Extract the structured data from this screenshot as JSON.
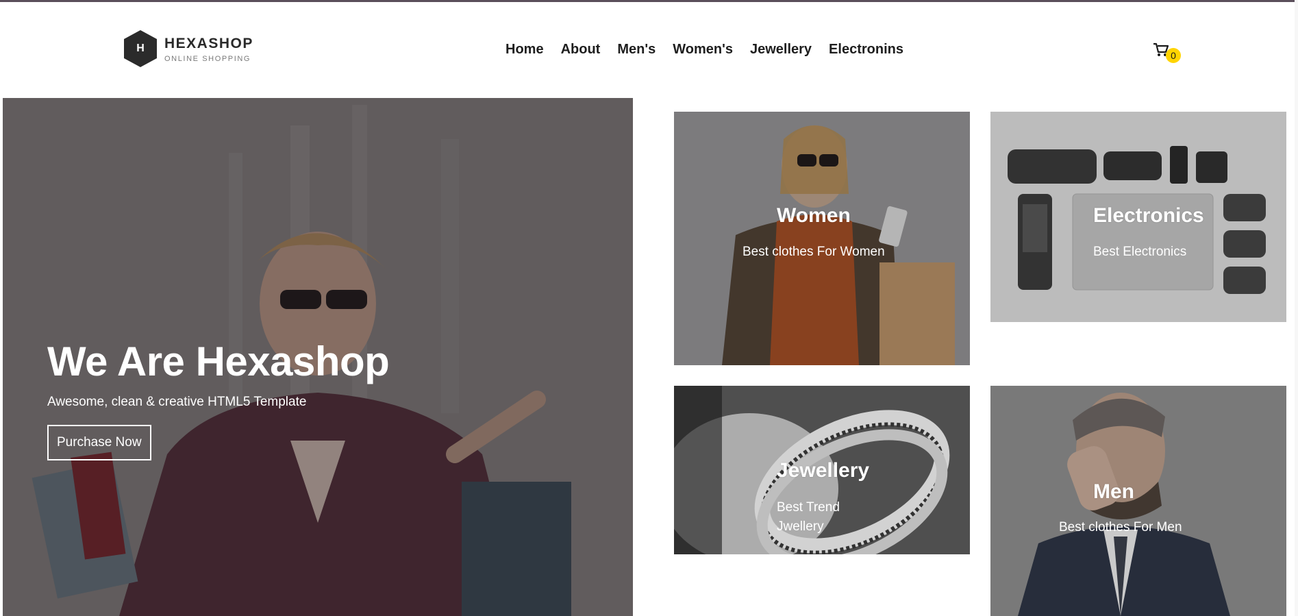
{
  "header": {
    "logo": {
      "letter": "H",
      "title": "HEXASHOP",
      "subtitle": "ONLINE SHOPPING"
    },
    "nav": [
      {
        "label": "Home"
      },
      {
        "label": "About"
      },
      {
        "label": "Men's"
      },
      {
        "label": "Women's"
      },
      {
        "label": "Jewellery"
      },
      {
        "label": "Electronins"
      }
    ],
    "cart": {
      "icon": "cart-icon",
      "count": "0"
    }
  },
  "hero": {
    "title": "We Are Hexashop",
    "subtitle": "Awesome, clean & creative HTML5 Template",
    "button_label": "Purchase Now"
  },
  "categories": [
    {
      "title": "Women",
      "subtitle": "Best clothes For Women"
    },
    {
      "title": "Electronics",
      "subtitle": "Best Electronics"
    },
    {
      "title": "Jewellery",
      "subtitle": "Best Trend Jwellery"
    },
    {
      "title": "Men",
      "subtitle": "Best clothes For Men"
    }
  ],
  "colors": {
    "accent_badge": "#ffd400",
    "text_dark": "#1e1e1e",
    "logo_hex": "#2b2b2b",
    "top_line": "#5b4f5b"
  }
}
